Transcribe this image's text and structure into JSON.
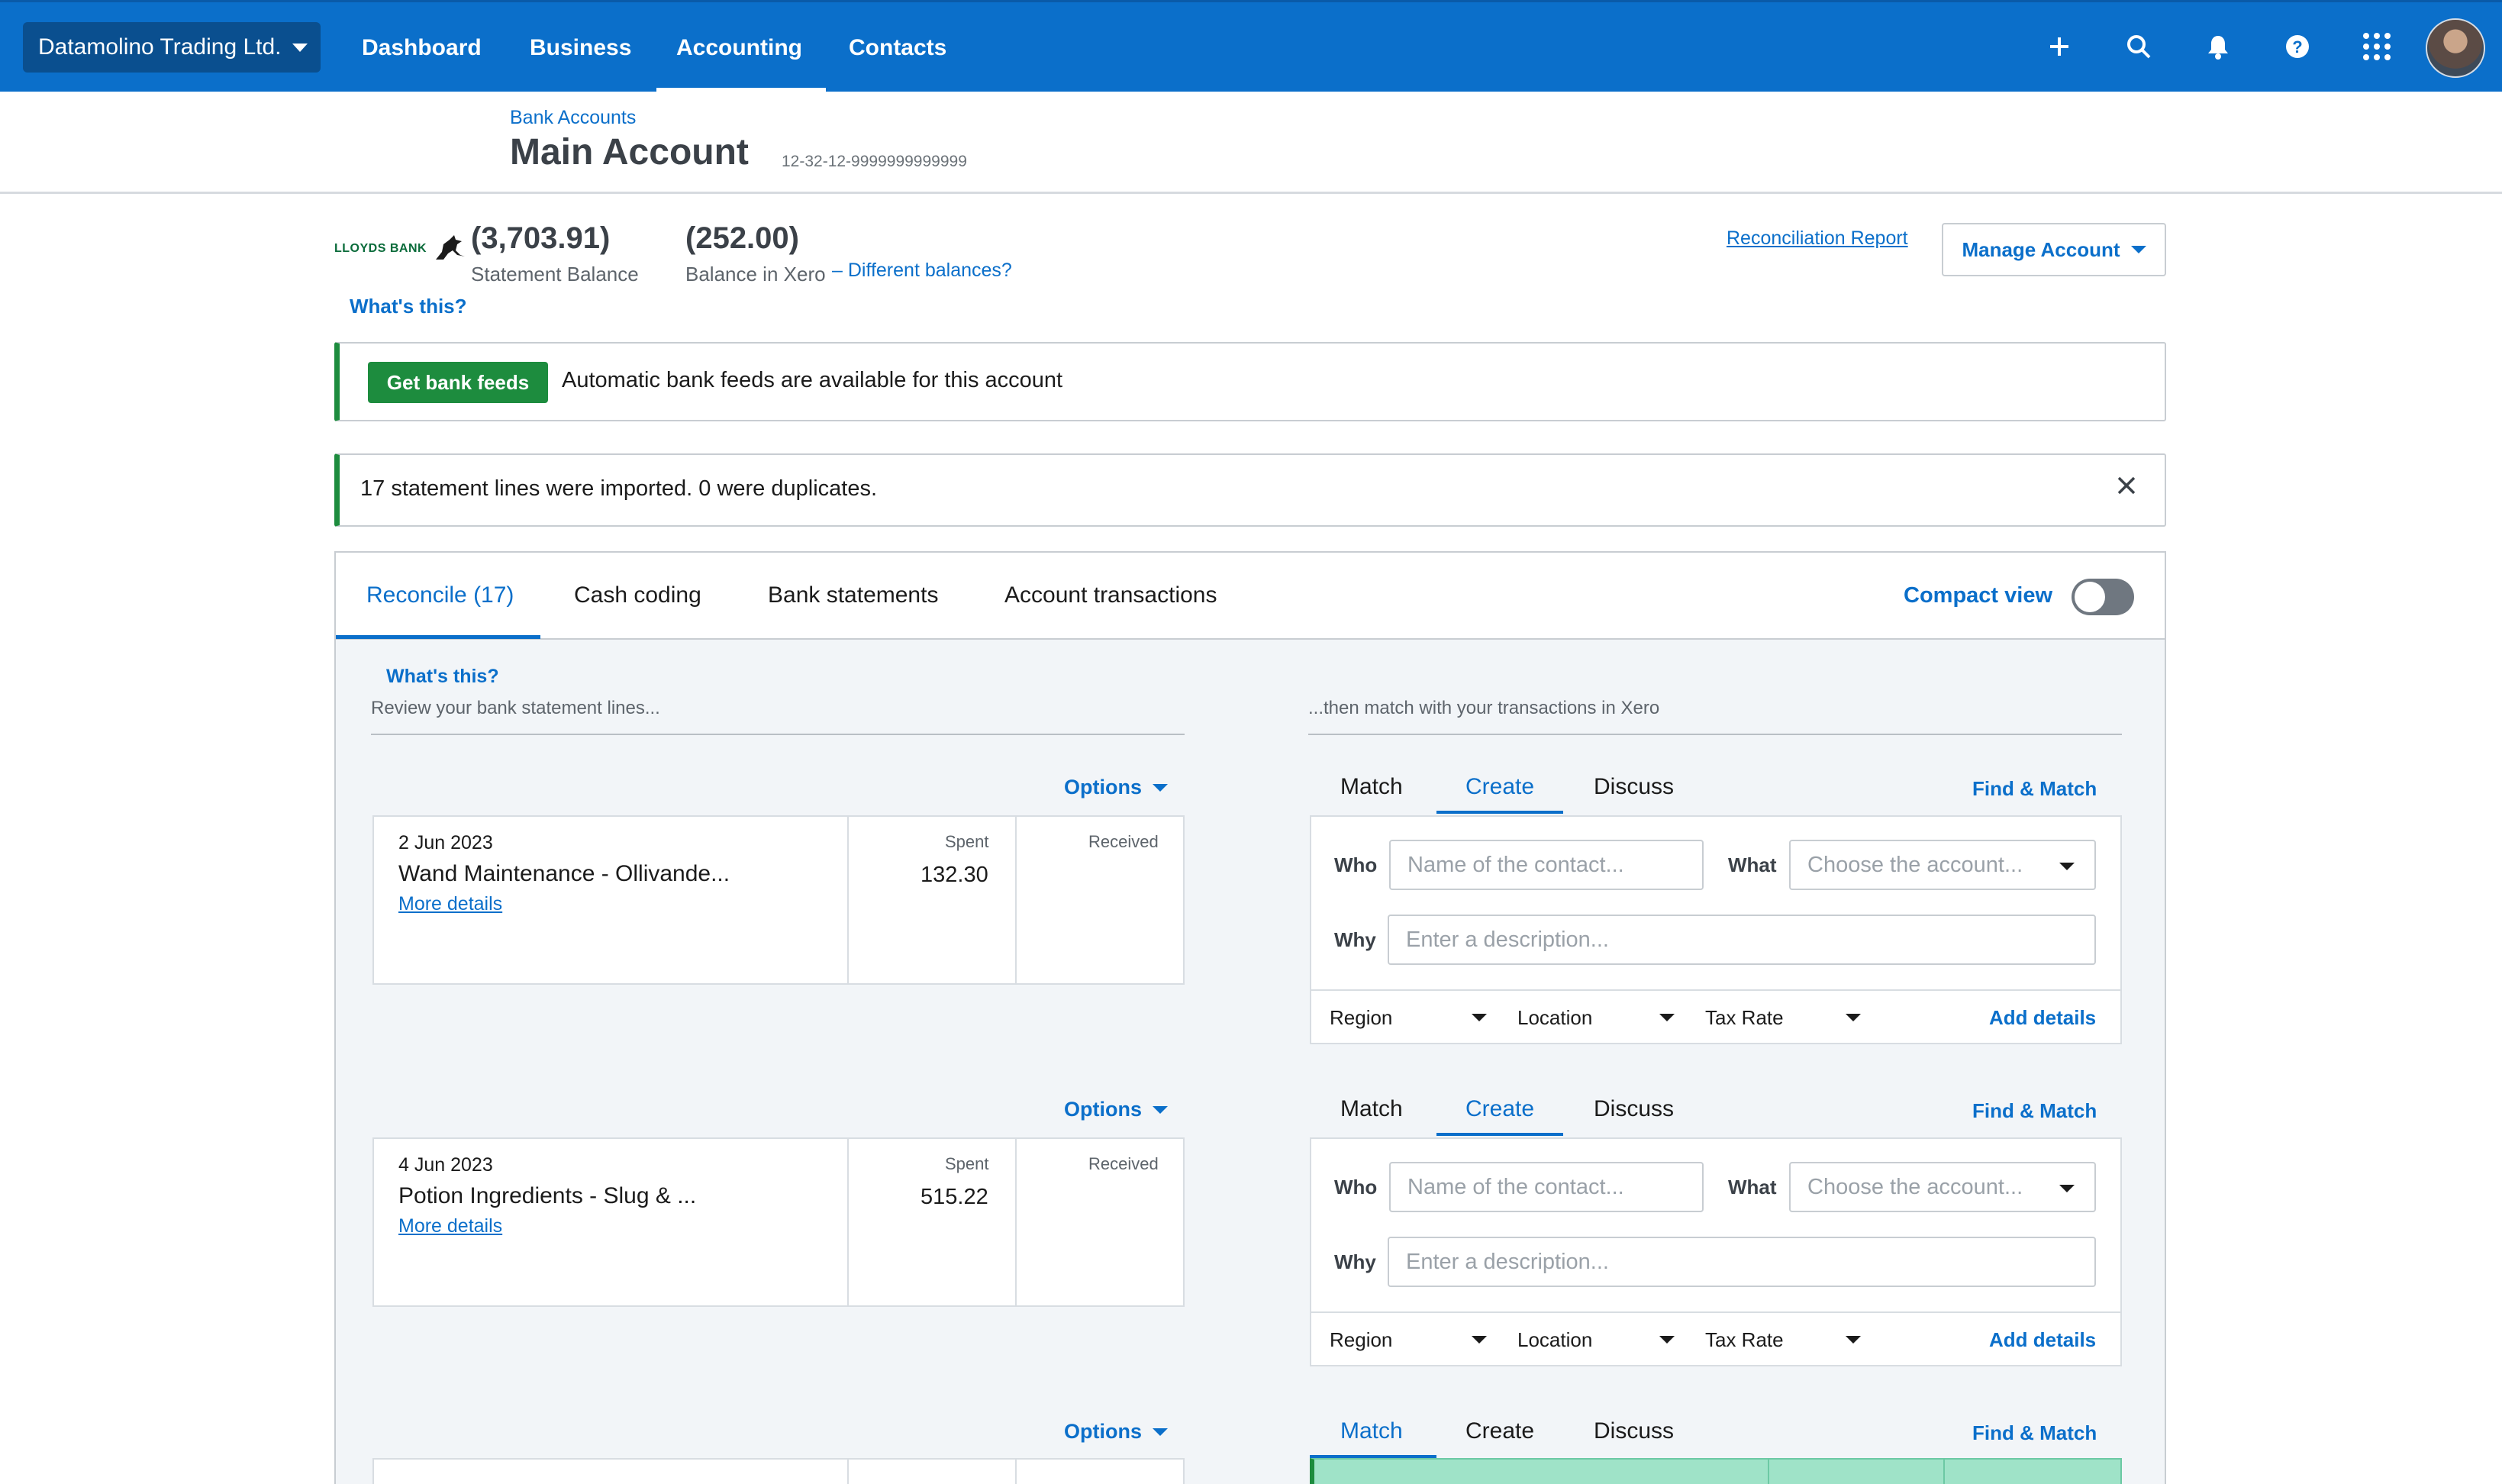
{
  "nav": {
    "org_name": "Datamolino Trading Ltd.",
    "items": [
      "Dashboard",
      "Business",
      "Accounting",
      "Contacts"
    ],
    "active_item": "Accounting",
    "icons": [
      "plus-icon",
      "search-icon",
      "bell-icon",
      "help-icon",
      "apps-grid-icon",
      "avatar"
    ]
  },
  "header": {
    "breadcrumb": "Bank Accounts",
    "title": "Main Account",
    "account_number": "12-32-12-9999999999999"
  },
  "balances": {
    "bank_logo": "LLOYDS BANK",
    "statement_balance": "(3,703.91)",
    "statement_label": "Statement Balance",
    "xero_balance": "(252.00)",
    "xero_label": "Balance in Xero",
    "different_balances": "Different balances?",
    "whats_this": "What's this?",
    "reconciliation_report": "Reconciliation Report",
    "manage_account": "Manage Account"
  },
  "bank_feed_banner": {
    "button": "Get bank feeds",
    "text": "Automatic bank feeds are available for this account"
  },
  "import_banner": {
    "text": "17 statement lines were imported. 0 were duplicates."
  },
  "tabs": {
    "items": [
      "Reconcile (17)",
      "Cash coding",
      "Bank statements",
      "Account transactions"
    ],
    "active": "Reconcile (17)",
    "compact_view": "Compact view",
    "compact_view_on": false
  },
  "reconcile": {
    "whats_this": "What's this?",
    "left_heading": "Review your bank statement lines...",
    "right_heading": "...then match with your transactions in Xero",
    "options_label": "Options",
    "spent_label": "Spent",
    "received_label": "Received",
    "more_details": "More details",
    "match_tabs": [
      "Match",
      "Create",
      "Discuss"
    ],
    "find_match": "Find & Match",
    "who_label": "Who",
    "what_label": "What",
    "why_label": "Why",
    "who_placeholder": "Name of the contact...",
    "what_placeholder": "Choose the account...",
    "why_placeholder": "Enter a description...",
    "region_label": "Region",
    "location_label": "Location",
    "tax_rate_label": "Tax Rate",
    "add_details": "Add details",
    "lines": [
      {
        "date": "2 Jun 2023",
        "description": "Wand Maintenance - Ollivande...",
        "spent": "132.30",
        "received": "",
        "active_tab": "Create"
      },
      {
        "date": "4 Jun 2023",
        "description": "Potion Ingredients - Slug & ...",
        "spent": "515.22",
        "received": "",
        "active_tab": "Create"
      },
      {
        "date": "",
        "description": "",
        "spent": "",
        "received": "",
        "active_tab": "Match"
      }
    ]
  },
  "colors": {
    "nav_blue": "#0b6fca",
    "accent_blue": "#0b6fca",
    "green": "#1d8c3e",
    "match_green": "#9fe3c8"
  }
}
